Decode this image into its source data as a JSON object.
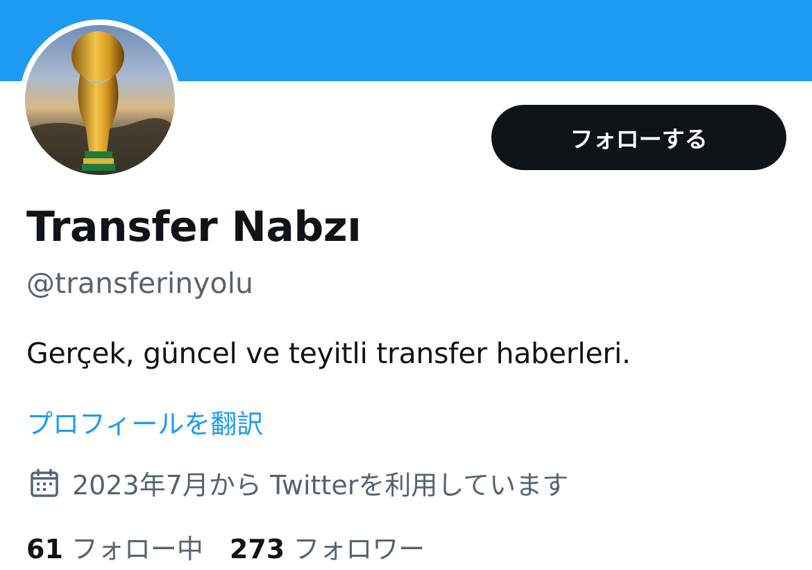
{
  "profile": {
    "display_name": "Transfer Nabzı",
    "handle": "@transferinyolu",
    "bio": "Gerçek, güncel ve teyitli transfer haberleri.",
    "translate_link": "プロフィールを翻訳",
    "joined": "2023年7月から Twitterを利用しています",
    "avatar_icon": "trophy-avatar"
  },
  "actions": {
    "follow_label": "フォローする"
  },
  "stats": {
    "following_count": "61",
    "following_label": "フォロー中",
    "followers_count": "273",
    "followers_label": "フォロワー"
  },
  "colors": {
    "banner": "#1d9bf0",
    "text_primary": "#0f1419",
    "text_secondary": "#536471",
    "link": "#1d9bf0",
    "button_bg": "#0f1419"
  }
}
